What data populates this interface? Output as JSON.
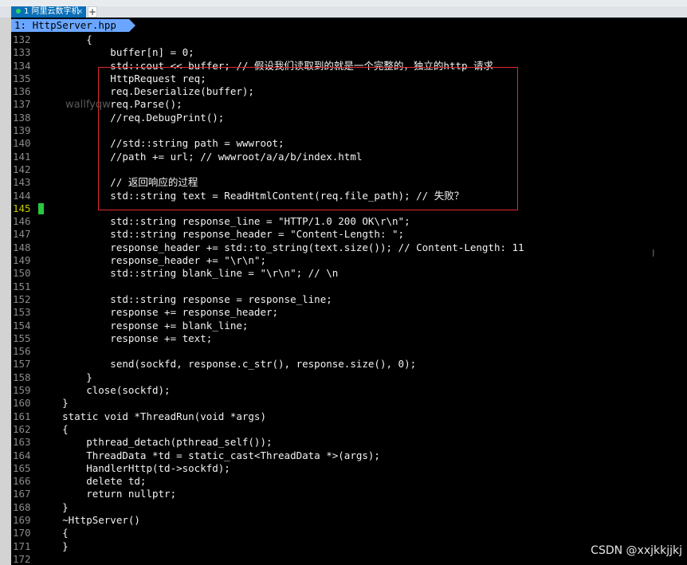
{
  "window": {
    "tab_title": "1 阿里云数字机",
    "tab_close": "×",
    "tab_add": "+"
  },
  "editor": {
    "buffer_tab": "1: HttpServer.hpp"
  },
  "watermark_left": "wallfyqw",
  "text_cursor_glyph": "I",
  "watermark": "CSDN @xxjkkjjkj",
  "lines": [
    {
      "n": "132",
      "t": "        {"
    },
    {
      "n": "133",
      "t": "            buffer[n] = 0;"
    },
    {
      "n": "134",
      "t": "            std::cout << buffer; // 假设我们读取到的就是一个完整的，独立的http 请求"
    },
    {
      "n": "135",
      "t": "            HttpRequest req;"
    },
    {
      "n": "136",
      "t": "            req.Deserialize(buffer);"
    },
    {
      "n": "137",
      "t": "            req.Parse();"
    },
    {
      "n": "138",
      "t": "            //req.DebugPrint();"
    },
    {
      "n": "139",
      "t": ""
    },
    {
      "n": "140",
      "t": "            //std::string path = wwwroot;"
    },
    {
      "n": "141",
      "t": "            //path += url; // wwwroot/a/a/b/index.html"
    },
    {
      "n": "142",
      "t": ""
    },
    {
      "n": "143",
      "t": "            // 返回响应的过程"
    },
    {
      "n": "144",
      "t": "            std::string text = ReadHtmlContent(req.file_path); // 失败？"
    },
    {
      "n": "145",
      "t": ""
    },
    {
      "n": "146",
      "t": "            std::string response_line = \"HTTP/1.0 200 OK\\r\\n\";"
    },
    {
      "n": "147",
      "t": "            std::string response_header = \"Content-Length: \";"
    },
    {
      "n": "148",
      "t": "            response_header += std::to_string(text.size()); // Content-Length: 11"
    },
    {
      "n": "149",
      "t": "            response_header += \"\\r\\n\";"
    },
    {
      "n": "150",
      "t": "            std::string blank_line = \"\\r\\n\"; // \\n"
    },
    {
      "n": "151",
      "t": ""
    },
    {
      "n": "152",
      "t": "            std::string response = response_line;"
    },
    {
      "n": "153",
      "t": "            response += response_header;"
    },
    {
      "n": "154",
      "t": "            response += blank_line;"
    },
    {
      "n": "155",
      "t": "            response += text;"
    },
    {
      "n": "156",
      "t": ""
    },
    {
      "n": "157",
      "t": "            send(sockfd, response.c_str(), response.size(), 0);"
    },
    {
      "n": "158",
      "t": "        }"
    },
    {
      "n": "159",
      "t": "        close(sockfd);"
    },
    {
      "n": "160",
      "t": "    }"
    },
    {
      "n": "161",
      "t": "    static void *ThreadRun(void *args)"
    },
    {
      "n": "162",
      "t": "    {"
    },
    {
      "n": "163",
      "t": "        pthread_detach(pthread_self());"
    },
    {
      "n": "164",
      "t": "        ThreadData *td = static_cast<ThreadData *>(args);"
    },
    {
      "n": "165",
      "t": "        HandlerHttp(td->sockfd);"
    },
    {
      "n": "166",
      "t": "        delete td;"
    },
    {
      "n": "167",
      "t": "        return nullptr;"
    },
    {
      "n": "168",
      "t": "    }"
    },
    {
      "n": "169",
      "t": "    ~HttpServer()"
    },
    {
      "n": "170",
      "t": "    {"
    },
    {
      "n": "171",
      "t": "    }"
    },
    {
      "n": "172",
      "t": ""
    }
  ]
}
